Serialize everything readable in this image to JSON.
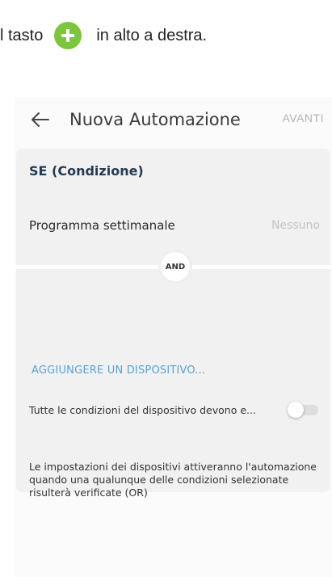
{
  "instruction": {
    "before": "l tasto",
    "icon": "add-circle-icon",
    "after": "in alto a destra.",
    "icon_color": "#7bc63b"
  },
  "header": {
    "back_icon": "arrow-left-icon",
    "title": "Nuova Automazione",
    "next_label": "AVANTI"
  },
  "condition": {
    "section_title": "SE (Condizione)",
    "schedule_label": "Programma settimanale",
    "schedule_value": "Nessuno",
    "operator": "AND",
    "add_device": "AGGIUNGERE UN DISPOSITIVO...",
    "all_conditions_label": "Tutte le condizioni del dispositivo devono e...",
    "all_conditions_enabled": false,
    "note": "Le impostazioni dei dispositivi attiveranno l'automazione quando una qualunque delle condizioni selezionate risulterà verificate (OR)"
  },
  "colors": {
    "accent_link": "#5aa2d6",
    "title_dark": "#243b55",
    "card_bg": "#f1f1f1"
  }
}
